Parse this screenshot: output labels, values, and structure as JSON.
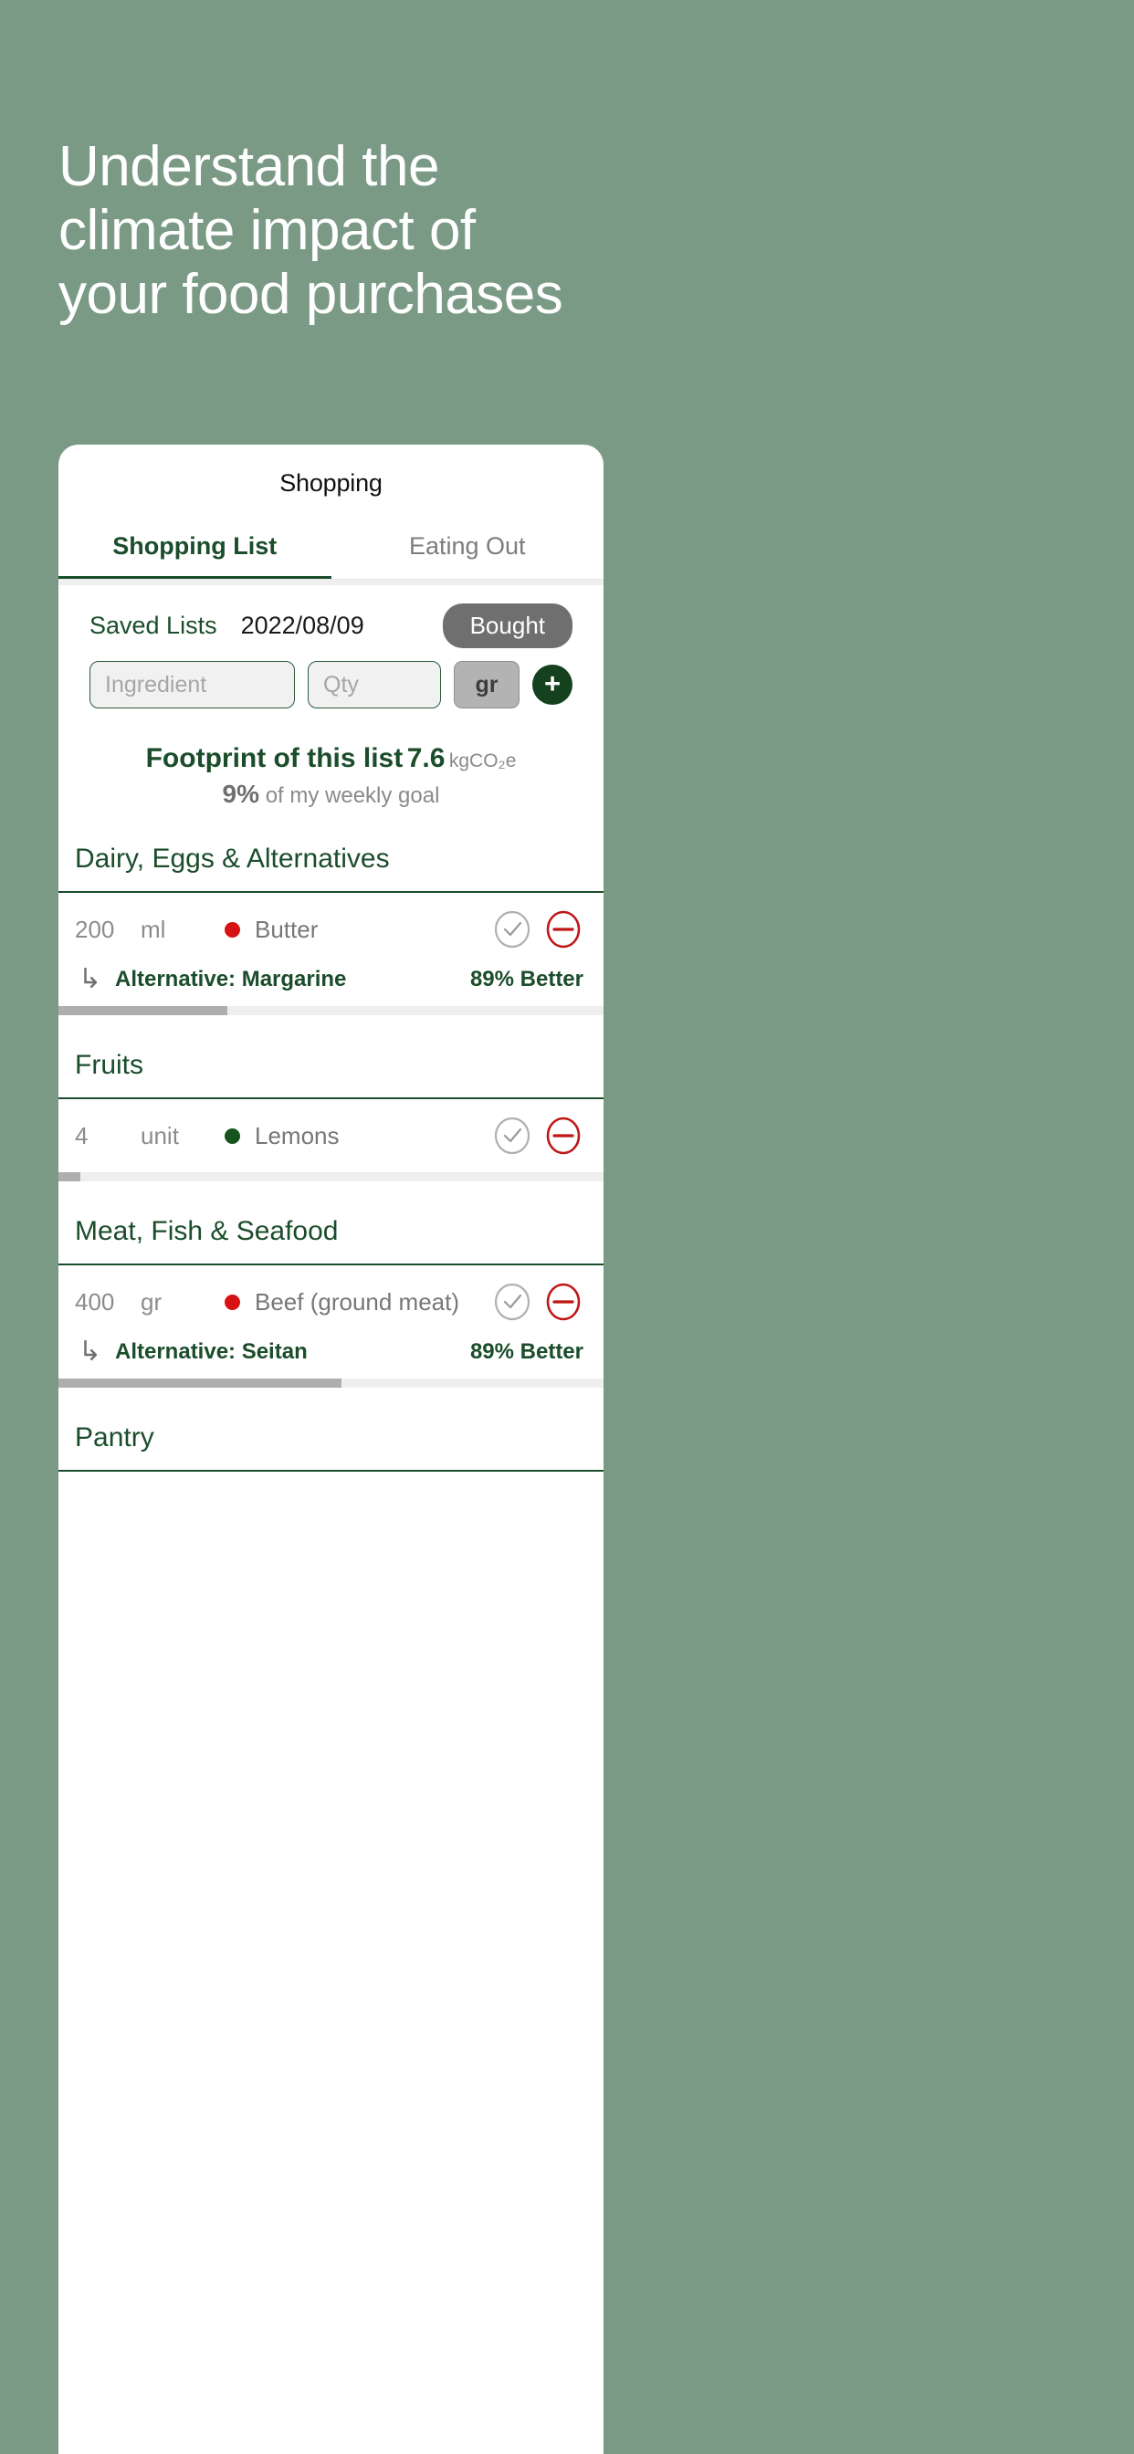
{
  "hero": {
    "lines": [
      "Understand the",
      "climate impact of",
      "your food purchases"
    ],
    "bg_color": "#7a9a85",
    "text_color": "#ffffff"
  },
  "app": {
    "title": "Shopping",
    "tabs": [
      {
        "label": "Shopping List",
        "active": true
      },
      {
        "label": "Eating Out",
        "active": false
      }
    ],
    "toolbar": {
      "saved_lists_label": "Saved Lists",
      "date": "2022/08/09",
      "bought_label": "Bought"
    },
    "add_form": {
      "ingredient_placeholder": "Ingredient",
      "qty_placeholder": "Qty",
      "unit_label": "gr",
      "add_icon": "plus-icon"
    },
    "footprint": {
      "label": "Footprint of this list",
      "value": "7.6",
      "unit": "kgCO₂e",
      "percent": "9%",
      "goal_text": "of my weekly goal"
    },
    "colors": {
      "brand_green": "#1b4d2b",
      "bad_red": "#cc1111",
      "good_green": "#15541f",
      "muted": "#8c8c8c",
      "bar_fill": "#aeaeae"
    },
    "sections": [
      {
        "title": "Dairy, Eggs & Alternatives",
        "items": [
          {
            "qty": "200",
            "unit": "ml",
            "name": "Butter",
            "dot_color": "#d81212",
            "check_icon": "check-circle-icon",
            "remove_icon": "minus-circle-icon",
            "alternative": "Alternative: Margarine",
            "better": "89% Better",
            "bar_percent": 31
          }
        ]
      },
      {
        "title": "Fruits",
        "items": [
          {
            "qty": "4",
            "unit": "unit",
            "name": "Lemons",
            "dot_color": "#15541f",
            "check_icon": "check-circle-icon",
            "remove_icon": "minus-circle-icon",
            "alternative": null,
            "better": null,
            "bar_percent": 4
          }
        ]
      },
      {
        "title": "Meat, Fish & Seafood",
        "items": [
          {
            "qty": "400",
            "unit": "gr",
            "name": "Beef (ground meat)",
            "dot_color": "#d81212",
            "check_icon": "check-circle-icon",
            "remove_icon": "minus-circle-icon",
            "alternative": "Alternative: Seitan",
            "better": "89% Better",
            "bar_percent": 52
          }
        ]
      },
      {
        "title": "Pantry",
        "items": []
      }
    ]
  }
}
